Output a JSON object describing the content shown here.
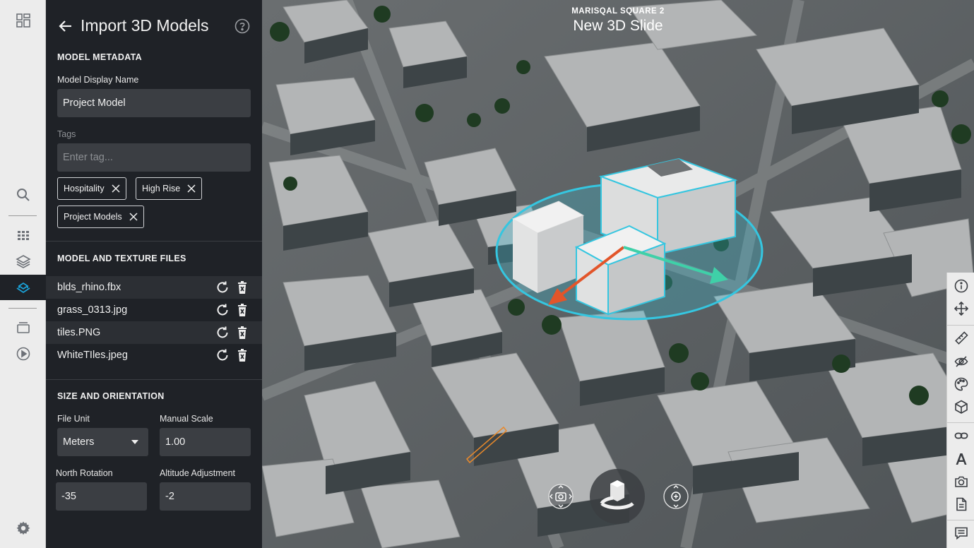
{
  "panel": {
    "title": "Import 3D Models",
    "metadata": {
      "section_title": "MODEL METADATA",
      "display_name_label": "Model Display Name",
      "display_name_value": "Project Model",
      "tags_label": "Tags",
      "tags_placeholder": "Enter tag...",
      "tags": [
        "Hospitality",
        "High Rise",
        "Project Models"
      ]
    },
    "files": {
      "section_title": "MODEL AND TEXTURE FILES",
      "items": [
        "blds_rhino.fbx",
        "grass_0313.jpg",
        "tiles.PNG",
        "WhiteTIles.jpeg"
      ]
    },
    "size": {
      "section_title": "SIZE AND ORIENTATION",
      "file_unit_label": "File Unit",
      "file_unit_value": "Meters",
      "manual_scale_label": "Manual Scale",
      "manual_scale_value": "1.00",
      "north_rotation_label": "North Rotation",
      "north_rotation_value": "-35",
      "altitude_label": "Altitude Adjustment",
      "altitude_value": "-2"
    }
  },
  "viewer": {
    "project_name": "MARISQAL SQUARE 2",
    "slide_title": "New 3D Slide"
  },
  "colors": {
    "accent": "#1aa3d9",
    "panel_bg": "#1f2227",
    "selection": "#35c6e0",
    "axis_x": "#e2552a",
    "axis_y": "#3fd0a8"
  }
}
